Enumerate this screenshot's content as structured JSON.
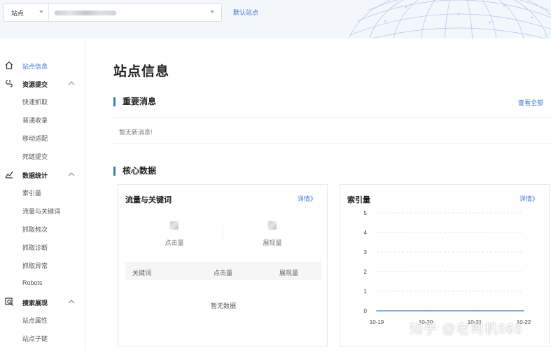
{
  "topbar": {
    "site_label": "站点",
    "default_site": "默认站点"
  },
  "sidebar": {
    "items": [
      {
        "label": "站点信息",
        "kind": "active"
      },
      {
        "label": "资源提交",
        "kind": "group"
      },
      {
        "label": "快速抓取",
        "kind": "sub"
      },
      {
        "label": "普通收录",
        "kind": "sub"
      },
      {
        "label": "移动适配",
        "kind": "sub"
      },
      {
        "label": "死链提交",
        "kind": "sub"
      },
      {
        "label": "数据统计",
        "kind": "group"
      },
      {
        "label": "索引量",
        "kind": "sub"
      },
      {
        "label": "流量与关键词",
        "kind": "sub"
      },
      {
        "label": "抓取频次",
        "kind": "sub"
      },
      {
        "label": "抓取诊断",
        "kind": "sub"
      },
      {
        "label": "抓取异常",
        "kind": "sub"
      },
      {
        "label": "Robots",
        "kind": "sub"
      },
      {
        "label": "搜索展现",
        "kind": "group"
      },
      {
        "label": "站点属性",
        "kind": "sub"
      },
      {
        "label": "站点子链",
        "kind": "sub"
      }
    ]
  },
  "main": {
    "title": "站点信息",
    "news": {
      "title": "重要消息",
      "view_all": "查看全部",
      "empty": "暂无新消息!"
    },
    "core": {
      "title": "核心数据",
      "traffic": {
        "title": "流量与关键词",
        "link": "详情》",
        "metric_clicks": "点击量",
        "metric_impressions": "展现量",
        "col_keyword": "关键词",
        "col_clicks": "点击量",
        "col_impressions": "展现量",
        "empty": "暂无数据"
      },
      "index": {
        "title": "索引量",
        "link": "详情》"
      }
    }
  },
  "watermark": "知乎 @老司机666",
  "colors": {
    "accent": "#3a78d6",
    "line": "#5b8fd9",
    "grid": "#e2e6ee"
  },
  "chart_data": {
    "type": "line",
    "title": "",
    "x": [
      "10-19",
      "10-20",
      "10-21",
      "10-22"
    ],
    "series": [
      {
        "values": [
          0,
          0,
          0,
          0
        ]
      }
    ],
    "ylim": [
      0,
      5
    ],
    "yticks": [
      0,
      1,
      2,
      3,
      4,
      5
    ],
    "grid": true
  }
}
